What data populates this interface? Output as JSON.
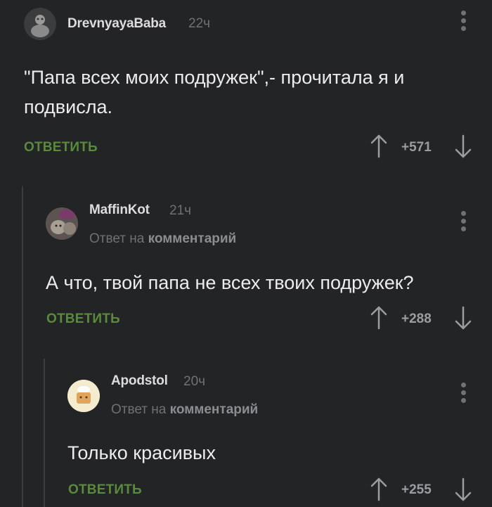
{
  "comments": [
    {
      "author": "DrevnyayaBaba",
      "time": "22ч",
      "text_line1": "\"Папа всех моих подружек\",- прочитала я и",
      "text_line2": "подвисла.",
      "reply_label": "ОТВЕТИТЬ",
      "score": "+571"
    },
    {
      "author": "MaffinKot",
      "time": "21ч",
      "reply_prefix": "Ответ на",
      "reply_target": "комментарий",
      "text_line1": "А что, твой папа не всех твоих подружек?",
      "reply_label": "ОТВЕТИТЬ",
      "score": "+288"
    },
    {
      "author": "Apodstol",
      "time": "20ч",
      "reply_prefix": "Ответ на",
      "reply_target": "комментарий",
      "text_line1": "Только красивых",
      "reply_label": "ОТВЕТИТЬ",
      "score": "+255"
    }
  ],
  "colors": {
    "background": "#222425",
    "reply_button": "#5a8a3c",
    "muted": "#6e7274"
  },
  "icons": {
    "vote_up": "arrow-up-icon",
    "vote_down": "arrow-down-icon",
    "more": "more-vertical-icon"
  }
}
